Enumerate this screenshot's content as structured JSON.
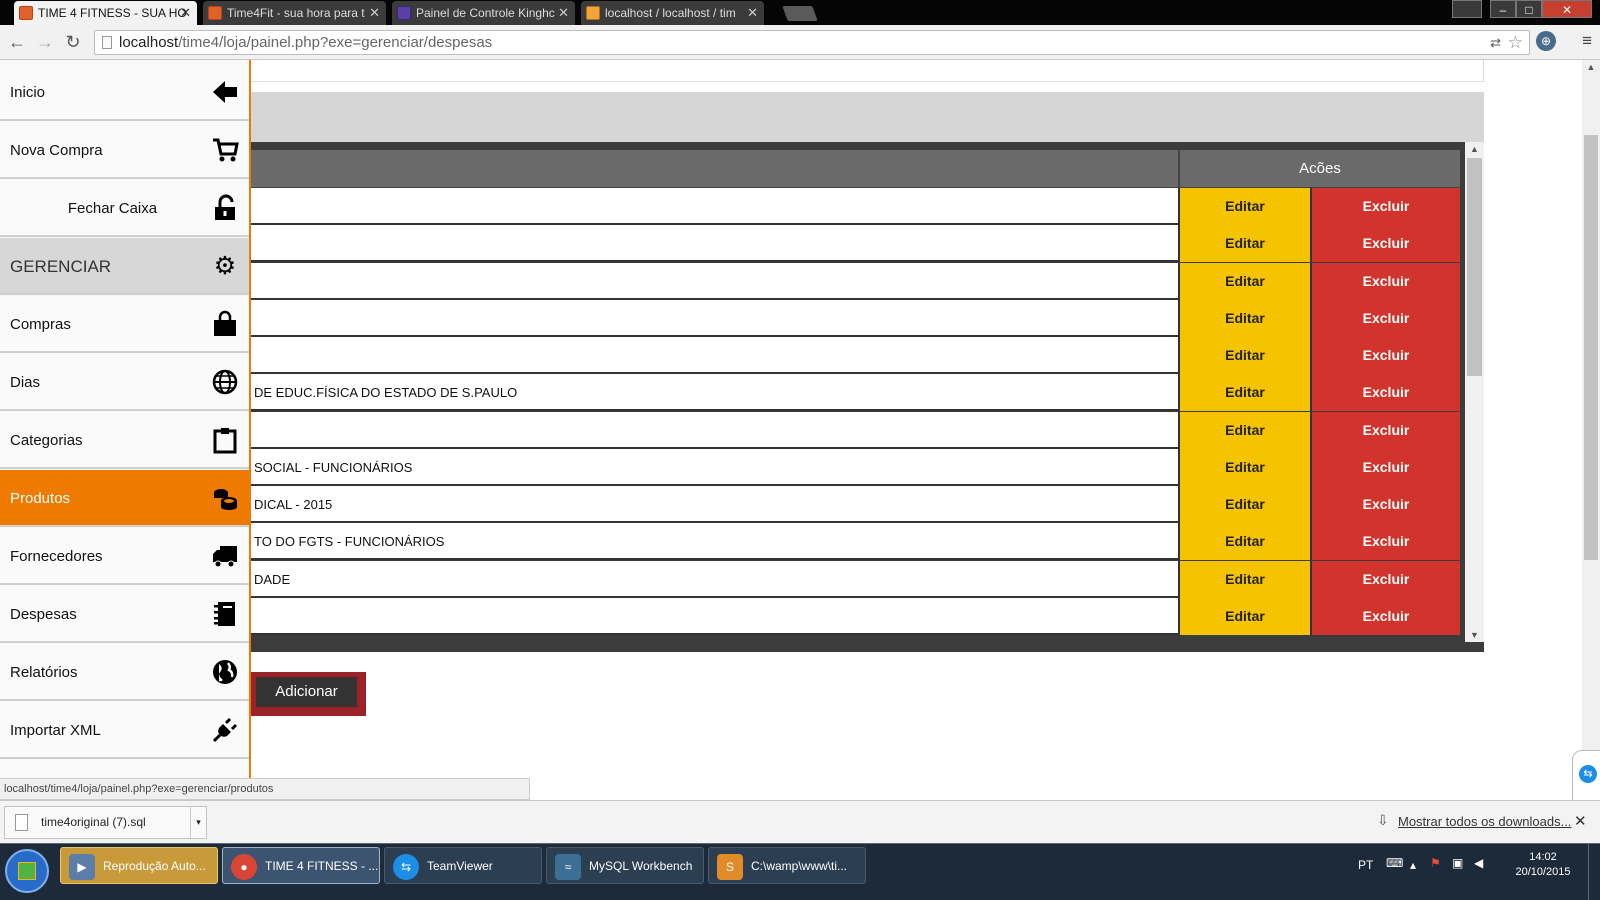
{
  "browser": {
    "tabs": [
      {
        "title": "TIME 4 FITNESS - SUA HO",
        "active": true
      },
      {
        "title": "Time4Fit - sua hora para t"
      },
      {
        "title": "Painel de Controle Kinghc"
      },
      {
        "title": "localhost / localhost / tim"
      }
    ],
    "url_host": "localhost",
    "url_path": "/time4/loja/painel.php?exe=gerenciar/despesas",
    "window_buttons": [
      "–",
      "□",
      "✕"
    ]
  },
  "sidebar": {
    "items": [
      {
        "label": "Inicio",
        "icon": "arrow-left-icon"
      },
      {
        "label": "Nova Compra",
        "icon": "cart-icon"
      },
      {
        "label": "Fechar Caixa",
        "icon": "unlock-icon"
      },
      {
        "label": "GERENCIAR",
        "icon": "gear-icon"
      },
      {
        "label": "Compras",
        "icon": "shopping-bag-icon"
      },
      {
        "label": "Dias",
        "icon": "globe-icon"
      },
      {
        "label": "Categorias",
        "icon": "clipboard-icon"
      },
      {
        "label": "Produtos",
        "icon": "coins-icon"
      },
      {
        "label": "Fornecedores",
        "icon": "truck-icon"
      },
      {
        "label": "Despesas",
        "icon": "notebook-icon"
      },
      {
        "label": "Relatórios",
        "icon": "world-icon"
      },
      {
        "label": "Importar XML",
        "icon": "plug-icon"
      }
    ],
    "status_url": "localhost/time4/loja/painel.php?exe=gerenciar/produtos"
  },
  "table": {
    "actions_header": "Acões",
    "edit_label": "Editar",
    "delete_label": "Excluir",
    "rows": [
      "",
      "",
      "",
      "",
      "",
      "DE EDUC.FÍSICA DO ESTADO DE S.PAULO",
      "",
      "SOCIAL - FUNCIONÁRIOS",
      "DICAL - 2015",
      "TO DO FGTS - FUNCIONÁRIOS",
      "DADE",
      ""
    ]
  },
  "add_button": "Adicionar",
  "downloads": {
    "file": "time4original (7).sql",
    "show_all": "Mostrar todos os downloads..."
  },
  "taskbar": {
    "tasks": [
      "Reprodução Auto...",
      "TIME 4 FITNESS - ...",
      "TeamViewer",
      "MySQL Workbench",
      "C:\\wamp\\www\\ti..."
    ],
    "lang": "PT",
    "time": "14:02",
    "date": "20/10/2015"
  },
  "colors": {
    "accent_orange": "#ef7a00",
    "edit_yellow": "#f6c300",
    "delete_red": "#d0342c"
  }
}
